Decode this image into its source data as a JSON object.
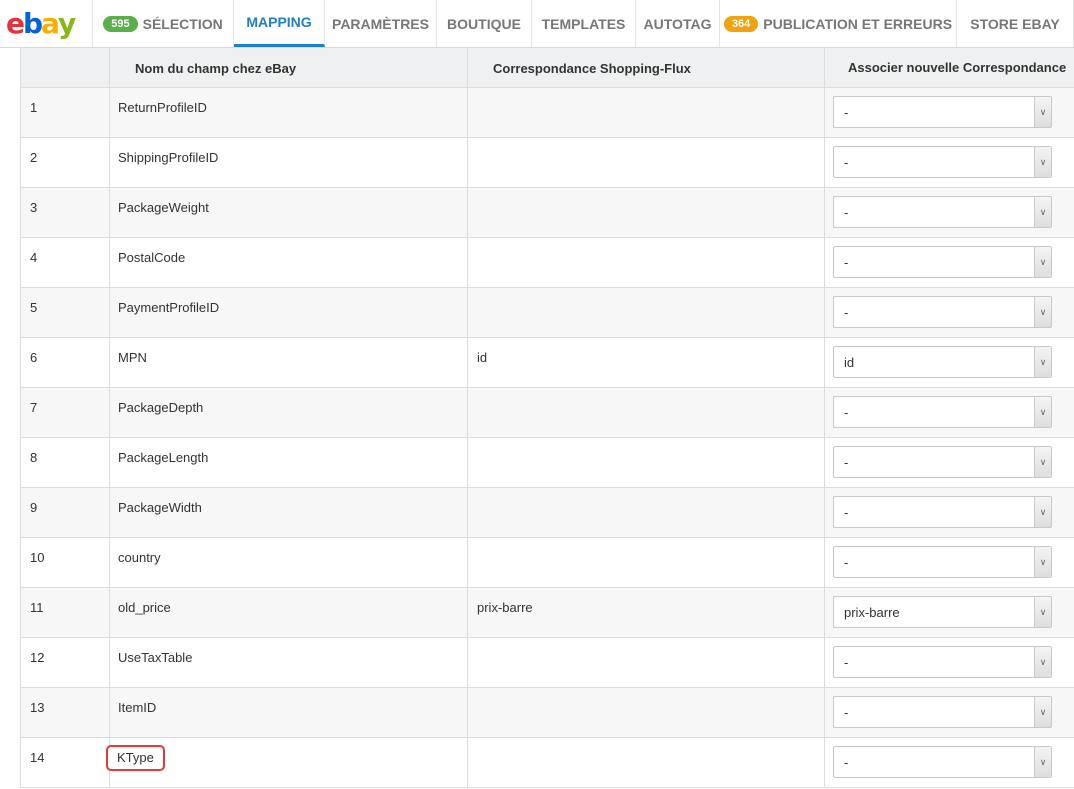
{
  "brand": {
    "logo_letters": [
      "e",
      "b",
      "a",
      "y"
    ],
    "logo_colors": [
      "#e53238",
      "#0064d2",
      "#f5af02",
      "#86b817"
    ]
  },
  "nav": {
    "tabs": [
      {
        "badge": "595",
        "badge_color": "green",
        "label": "Sélection",
        "active": false,
        "width": 141
      },
      {
        "badge": "",
        "label": "Mapping",
        "active": true,
        "width": 91
      },
      {
        "badge": "",
        "label": "Paramètres",
        "active": false,
        "width": 112
      },
      {
        "badge": "",
        "label": "Boutique",
        "active": false,
        "width": 95
      },
      {
        "badge": "",
        "label": "Templates",
        "active": false,
        "width": 104
      },
      {
        "badge": "",
        "label": "Autotag",
        "active": false,
        "width": 84
      },
      {
        "badge": "364",
        "badge_color": "orange",
        "label": "Publication et erreurs",
        "active": false,
        "width": 237
      },
      {
        "badge": "",
        "label": "Store eBay",
        "active": false,
        "width": 117
      }
    ]
  },
  "table": {
    "headers": {
      "index": "",
      "ebay_field": "Nom du champ chez eBay",
      "shoppingflux": "Correspondance Shopping-Flux",
      "new_mapping": "Associer nouvelle Correspondance"
    },
    "rows": [
      {
        "index": "1",
        "field": "ReturnProfileID",
        "mapping": "",
        "selected": "-",
        "highlight": false
      },
      {
        "index": "2",
        "field": "ShippingProfileID",
        "mapping": "",
        "selected": "-",
        "highlight": false
      },
      {
        "index": "3",
        "field": "PackageWeight",
        "mapping": "",
        "selected": "-",
        "highlight": false
      },
      {
        "index": "4",
        "field": "PostalCode",
        "mapping": "",
        "selected": "-",
        "highlight": false
      },
      {
        "index": "5",
        "field": "PaymentProfileID",
        "mapping": "",
        "selected": "-",
        "highlight": false
      },
      {
        "index": "6",
        "field": "MPN",
        "mapping": "id",
        "selected": "id",
        "highlight": false
      },
      {
        "index": "7",
        "field": "PackageDepth",
        "mapping": "",
        "selected": "-",
        "highlight": false
      },
      {
        "index": "8",
        "field": "PackageLength",
        "mapping": "",
        "selected": "-",
        "highlight": false
      },
      {
        "index": "9",
        "field": "PackageWidth",
        "mapping": "",
        "selected": "-",
        "highlight": false
      },
      {
        "index": "10",
        "field": "country",
        "mapping": "",
        "selected": "-",
        "highlight": false
      },
      {
        "index": "11",
        "field": "old_price",
        "mapping": "prix-barre",
        "selected": "prix-barre",
        "highlight": false
      },
      {
        "index": "12",
        "field": "UseTaxTable",
        "mapping": "",
        "selected": "-",
        "highlight": false
      },
      {
        "index": "13",
        "field": "ItemID",
        "mapping": "",
        "selected": "-",
        "highlight": false
      },
      {
        "index": "14",
        "field": "KType",
        "mapping": "",
        "selected": "-",
        "highlight": true
      }
    ]
  }
}
